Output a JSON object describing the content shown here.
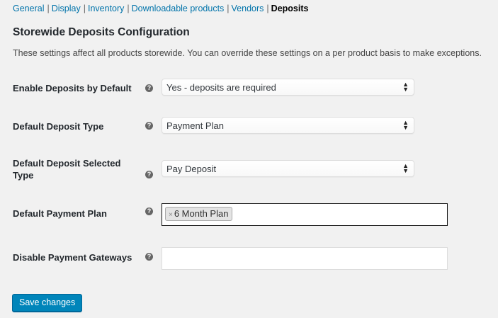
{
  "subnav": {
    "items": [
      {
        "label": "General"
      },
      {
        "label": "Display"
      },
      {
        "label": "Inventory"
      },
      {
        "label": "Downloadable products"
      },
      {
        "label": "Vendors"
      },
      {
        "label": "Deposits"
      }
    ],
    "separator": "|",
    "current": "Deposits"
  },
  "section": {
    "title": "Storewide Deposits Configuration",
    "description": "These settings affect all products storewide. You can override these settings on a per product basis to make exceptions."
  },
  "help_icon_glyph": "?",
  "fields": {
    "enable_deposits": {
      "label": "Enable Deposits by Default",
      "value": "Yes - deposits are required",
      "icon": "help-icon"
    },
    "deposit_type": {
      "label": "Default Deposit Type",
      "value": "Payment Plan",
      "icon": "help-icon"
    },
    "deposit_selected_type": {
      "label": "Default Deposit Selected Type",
      "value": "Pay Deposit",
      "icon": "help-icon"
    },
    "payment_plan": {
      "label": "Default Payment Plan",
      "tags": [
        "6 Month Plan"
      ],
      "remove_glyph": "×",
      "icon": "help-icon"
    },
    "disable_gateways": {
      "label": "Disable Payment Gateways",
      "tags": [],
      "icon": "help-icon"
    }
  },
  "save_button": {
    "label": "Save changes"
  },
  "colors": {
    "link": "#0073aa",
    "primary_button": "#0085ba",
    "background": "#f1f1f1"
  }
}
